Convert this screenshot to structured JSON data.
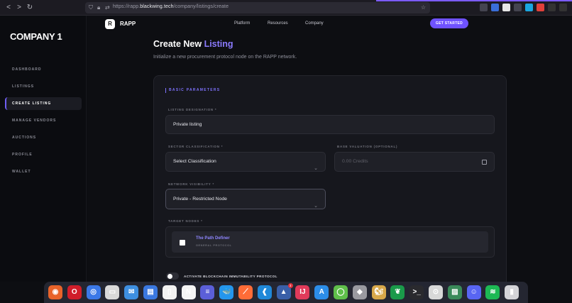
{
  "browser": {
    "url_prefix": "https://rapp.",
    "url_domain": "blackwing.tech",
    "url_path": "/company/listings/create",
    "extensions": [
      {
        "icon": "shield-icon",
        "color": "#444450"
      },
      {
        "icon": "download-icon",
        "color": "#3a6ed8"
      },
      {
        "icon": "avatar-icon",
        "color": "#e6e6e6"
      },
      {
        "icon": "puzzle-icon",
        "color": "#444450"
      },
      {
        "icon": "diamond-icon",
        "color": "#1aa6e0"
      },
      {
        "icon": "red-ext-icon",
        "color": "#e0403a"
      },
      {
        "icon": "pocket-icon",
        "color": "#333"
      },
      {
        "icon": "menu-icon",
        "color": "#333"
      }
    ]
  },
  "sidebar": {
    "company": "COMPANY 1",
    "items": [
      {
        "label": "DASHBOARD",
        "active": false
      },
      {
        "label": "LISTINGS",
        "active": false
      },
      {
        "label": "CREATE LISTING",
        "active": true
      },
      {
        "label": "MANAGE VENDORS",
        "active": false
      },
      {
        "label": "AUCTIONS",
        "active": false
      },
      {
        "label": "PROFILE",
        "active": false
      },
      {
        "label": "WALLET",
        "active": false
      }
    ]
  },
  "topnav": {
    "logo_letter": "R",
    "logo_text": "RAPP",
    "links": [
      "Platform",
      "Resources",
      "Company"
    ],
    "cta": "GET STARTED"
  },
  "page": {
    "title_main": "Create New ",
    "title_accent": "Listing",
    "subtitle": "Initialize a new procurement protocol node on the RAPP network."
  },
  "form": {
    "section": "BASIC PARAMETERS",
    "designation_label": "LISTING DESIGNATION *",
    "designation_value": "Private listing",
    "sector_label": "SECTOR CLASSIFICATION *",
    "sector_value": "Select Classification",
    "valuation_label": "BASE VALUATION (OPTIONAL)",
    "valuation_placeholder": "0.00 Credits",
    "visibility_label": "NETWORK VISIBILITY *",
    "visibility_value": "Private - Restricted Node",
    "nodes_label": "TARGET NODES *",
    "node_name": "The Path Definer",
    "node_sub": "GENERAL PROTOCOL",
    "toggle_label": "ACTIVATE BLOCKCHAIN IMMUTABILITY PROTOCOL"
  },
  "dock": [
    {
      "name": "firefox-icon",
      "color": "#e8632a",
      "glyph": "◉"
    },
    {
      "name": "opera-icon",
      "color": "#d01d2a",
      "glyph": "O"
    },
    {
      "name": "chromium-icon",
      "color": "#3b78e7",
      "glyph": "◎"
    },
    {
      "name": "files-icon",
      "color": "#d9d9d9",
      "glyph": "▭"
    },
    {
      "name": "mail-icon",
      "color": "#3e8fe0",
      "glyph": "✉"
    },
    {
      "name": "docs-icon",
      "color": "#3a78e0",
      "glyph": "▤"
    },
    {
      "name": "pdf-icon",
      "color": "#f2f2f2",
      "glyph": "▯"
    },
    {
      "name": "notion-icon",
      "color": "#f5f5f5",
      "glyph": "N"
    },
    {
      "name": "text-editor-icon",
      "color": "#5b5fd8",
      "glyph": "≡"
    },
    {
      "name": "docker-icon",
      "color": "#2496ed",
      "glyph": "🐳"
    },
    {
      "name": "postman-icon",
      "color": "#ff6c37",
      "glyph": "⟋"
    },
    {
      "name": "vscode-icon",
      "color": "#1f88d8",
      "glyph": "❰"
    },
    {
      "name": "android-studio-icon",
      "color": "#3a5fa8",
      "glyph": "▲",
      "badge": "3"
    },
    {
      "name": "jetbrains-icon",
      "color": "#e03a5a",
      "glyph": "IJ"
    },
    {
      "name": "app-store-icon",
      "color": "#2c8de8",
      "glyph": "A"
    },
    {
      "name": "circle-app-icon",
      "color": "#5fbf4a",
      "glyph": "◯"
    },
    {
      "name": "cube-app-icon",
      "color": "#9a9aa0",
      "glyph": "◆"
    },
    {
      "name": "dbeaver-icon",
      "color": "#d8a84a",
      "glyph": "🐿"
    },
    {
      "name": "mongodb-icon",
      "color": "#1a9a4a",
      "glyph": "❦"
    },
    {
      "name": "terminal-icon",
      "color": "#2a2a2e",
      "glyph": ">_"
    },
    {
      "name": "toggle-app-icon",
      "color": "#d8d8d8",
      "glyph": "⊙"
    },
    {
      "name": "image-viewer-icon",
      "color": "#3a8a5a",
      "glyph": "▨"
    },
    {
      "name": "discord-icon",
      "color": "#5865f2",
      "glyph": "☺"
    },
    {
      "name": "spotify-icon",
      "color": "#1db954",
      "glyph": "≋"
    },
    {
      "name": "trash-icon",
      "color": "#d4d4d8",
      "glyph": "▮"
    }
  ]
}
